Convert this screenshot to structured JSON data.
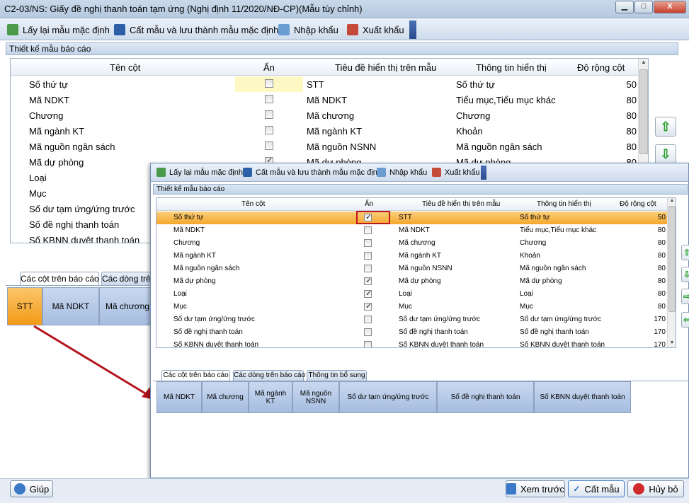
{
  "window": {
    "title": "C2-03/NS: Giấy đề nghị thanh toán tạm ứng (Nghị định 11/2020/NĐ-CP)(Mẫu tùy chỉnh)",
    "min_label": "▁",
    "max_label": "□",
    "close_label": "X"
  },
  "toolbar": {
    "reset_label": "Lấy lại mẫu mặc định",
    "save_as_label": "Cất mẫu và lưu thành mẫu mặc định",
    "import_label": "Nhập khẩu",
    "export_label": "Xuất khẩu"
  },
  "design": {
    "section_title": "Thiết kế mẫu báo cáo",
    "headers": {
      "col_name": "Tên cột",
      "hidden": "Ẩn",
      "display_title": "Tiêu đề hiển thị trên mẫu",
      "display_info": "Thông tin hiển thị",
      "width": "Độ rộng cột"
    },
    "rows": [
      {
        "name": "Số thứ tự",
        "hidden": false,
        "title": "STT",
        "info": "Số thứ tự",
        "width": "50"
      },
      {
        "name": "Mã NDKT",
        "hidden": false,
        "title": "Mã NDKT",
        "info": "Tiểu mục,Tiểu mục khác",
        "width": "80"
      },
      {
        "name": "Chương",
        "hidden": false,
        "title": "Mã chương",
        "info": "Chương",
        "width": "80"
      },
      {
        "name": "Mã ngành KT",
        "hidden": false,
        "title": "Mã ngành KT",
        "info": "Khoản",
        "width": "80"
      },
      {
        "name": "Mã nguồn ngân sách",
        "hidden": false,
        "title": "Mã nguồn NSNN",
        "info": "Mã nguồn ngân sách",
        "width": "80"
      },
      {
        "name": "Mã dự phòng",
        "hidden": true,
        "title": "Mã dự phòng",
        "info": "Mã dự phòng",
        "width": "80"
      },
      {
        "name": "Loại",
        "hidden": true,
        "title": "Loại",
        "info": "Loại",
        "width": "80"
      },
      {
        "name": "Mục",
        "hidden": true,
        "title": "Mục",
        "info": "Mục",
        "width": "80"
      },
      {
        "name": "Số dư tạm ứng/ứng trước",
        "hidden": false,
        "title": "Số dư tạm ứng/ứng trước",
        "info": "Số dư tạm ứng/ứng trước",
        "width": "170"
      },
      {
        "name": "Số đề nghị thanh toán",
        "hidden": false,
        "title": "Số đề nghị thanh toán",
        "info": "Số đề nghị thanh toán",
        "width": "170"
      },
      {
        "name": "Số KBNN duyệt thanh toán",
        "hidden": false,
        "title": "Số KBNN duyệt thanh toán",
        "info": "Số KBNN duyệt thanh toán",
        "width": "170"
      }
    ]
  },
  "tabs": {
    "columns": "Các cột trên báo cáo",
    "rows": "Các dòng trên báo cáo",
    "extra": "Thông tin bổ sung"
  },
  "back_columns": [
    "STT",
    "Mã NDKT",
    "Mã chương"
  ],
  "front_columns": [
    "Mã NDKT",
    "Mã chương",
    "Mã ngành KT",
    "Mã nguồn NSNN",
    "Số dư tạm ứng/ứng trước",
    "Số đề nghị thanh toán",
    "Số KBNN duyệt thanh toán"
  ],
  "footer": {
    "help_label": "Giúp",
    "preview_label": "Xem trước",
    "save_label": "Cất mẫu",
    "cancel_label": "Hủy bỏ"
  },
  "colors": {
    "selected_row": "#f7b54a",
    "highlight_box": "#c0141c",
    "arrow": "#b3141c",
    "cell_blue": "#b4c8e8"
  }
}
